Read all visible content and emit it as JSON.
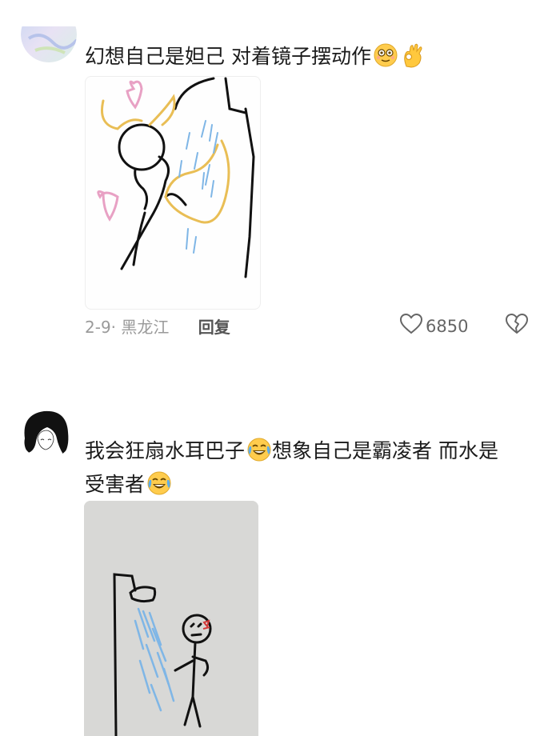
{
  "comments": [
    {
      "username": "",
      "text": "幻想自己是妲己 对着镜子摆动作",
      "emojis": [
        "flushed-smile-emoji",
        "ok-hand-emoji"
      ],
      "image": "drawing-woman-at-mirror",
      "date": "2-9",
      "location": "黑龙江",
      "reply_label": "回复",
      "likes": "6850"
    },
    {
      "username": "",
      "text_line1": "我会狂扇水耳巴子",
      "text_line1b": "想象自己是霸凌者 而水是",
      "text_line2": "受害者",
      "emojis": [
        "laugh-cry-emoji",
        "laugh-cry-emoji"
      ],
      "image": "drawing-stickman-shower"
    }
  ]
}
